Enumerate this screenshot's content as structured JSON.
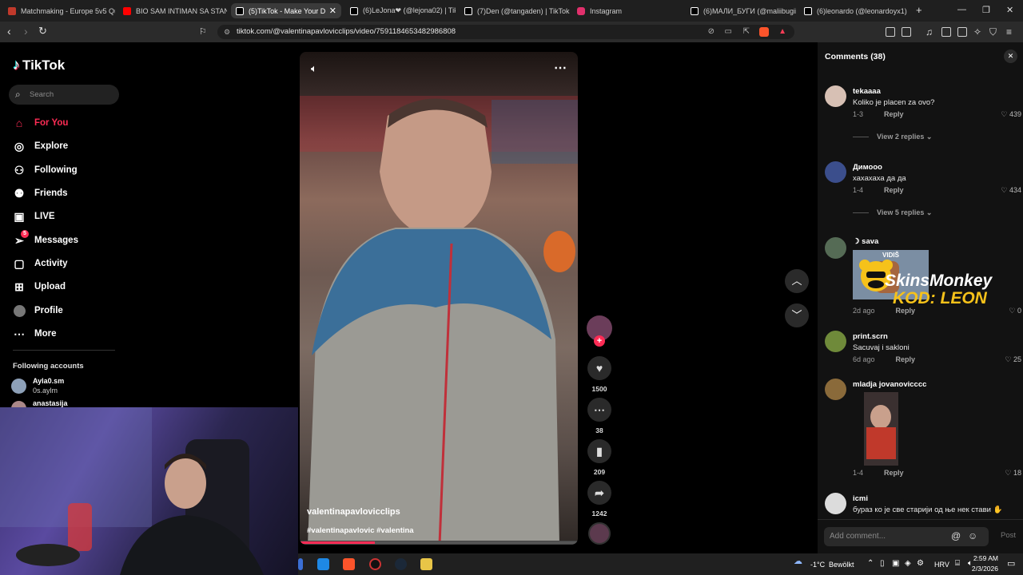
{
  "browser": {
    "tabs": [
      {
        "label": "Matchmaking - Europe 5v5 Qu",
        "color": "#c0392b"
      },
      {
        "label": "BIO SAM INTIMAN SA STANIJ",
        "color": "#ff0000"
      },
      {
        "label": "(5)TikTok - Make Your D",
        "color": "#ffffff"
      },
      {
        "label": "(6)LeJona❤ (@lejona02) | TikT",
        "color": "#ffffff"
      },
      {
        "label": "(7)Den (@tangaden) | TikTok",
        "color": "#ffffff"
      },
      {
        "label": "Instagram",
        "color": "#e1306c"
      },
      {
        "label": "(6)МАЛИ_БУГИ (@maliibugii",
        "color": "#ffffff"
      },
      {
        "label": "(6)leonardo (@leonardoyx1) | T",
        "color": "#ffffff"
      }
    ],
    "url": "tiktok.com/@valentinapavlovicclips/video/7591184653482986808"
  },
  "sidebar": {
    "logo": "TikTok",
    "search_placeholder": "Search",
    "items": [
      {
        "label": "For You",
        "icon": "home-icon"
      },
      {
        "label": "Explore",
        "icon": "compass-icon"
      },
      {
        "label": "Following",
        "icon": "following-icon"
      },
      {
        "label": "Friends",
        "icon": "friends-icon"
      },
      {
        "label": "LIVE",
        "icon": "live-icon"
      },
      {
        "label": "Messages",
        "icon": "messages-icon",
        "badge": "5"
      },
      {
        "label": "Activity",
        "icon": "activity-icon"
      },
      {
        "label": "Upload",
        "icon": "upload-icon"
      },
      {
        "label": "Profile",
        "icon": "avatar"
      },
      {
        "label": "More",
        "icon": "more-icon"
      }
    ],
    "following_title": "Following accounts",
    "following": [
      {
        "name": "Ayla0.sm",
        "sub": "0s.aylm"
      },
      {
        "name": "anastasija"
      }
    ]
  },
  "video": {
    "author": "valentinapavlovicclips",
    "hashtags": "#valentinapavlovic #valentina",
    "progress": 0.27
  },
  "actions": {
    "likes": "1500",
    "comments": "38",
    "saves": "209",
    "shares": "1242"
  },
  "comments": {
    "title": "Comments",
    "count": "(38)",
    "items": [
      {
        "user": "tekaaaa",
        "text": "Koliko je placen za ovo?",
        "date": "1-3",
        "reply": "Reply",
        "likes": "439",
        "views": "View 2 replies"
      },
      {
        "user": "Димооо",
        "text": "хахахаха да да",
        "date": "1-4",
        "reply": "Reply",
        "likes": "434",
        "views": "View 5 replies"
      },
      {
        "user": "sava",
        "sticker": "VIDIŠ",
        "date": "2d ago",
        "reply": "Reply",
        "likes": "0"
      },
      {
        "user": "print.scrn",
        "text": "Sacuvaj i sakloni",
        "date": "6d ago",
        "reply": "Reply",
        "likes": "25"
      },
      {
        "user": "mladja jovanovicccc",
        "date": "1-4",
        "reply": "Reply",
        "likes": "18"
      },
      {
        "user": "icmi",
        "text": "бураз ко је све старији од њe нек стави ✋"
      }
    ],
    "add_placeholder": "Add comment...",
    "post_label": "Post"
  },
  "overlay": {
    "brand": "SkinsMonkey",
    "code": "KOD: LEON"
  },
  "taskbar": {
    "temp": "-1°C",
    "weather": "Bewölkt",
    "lang": "HRV",
    "time": "2:59 AM",
    "date": "2/3/2026"
  }
}
